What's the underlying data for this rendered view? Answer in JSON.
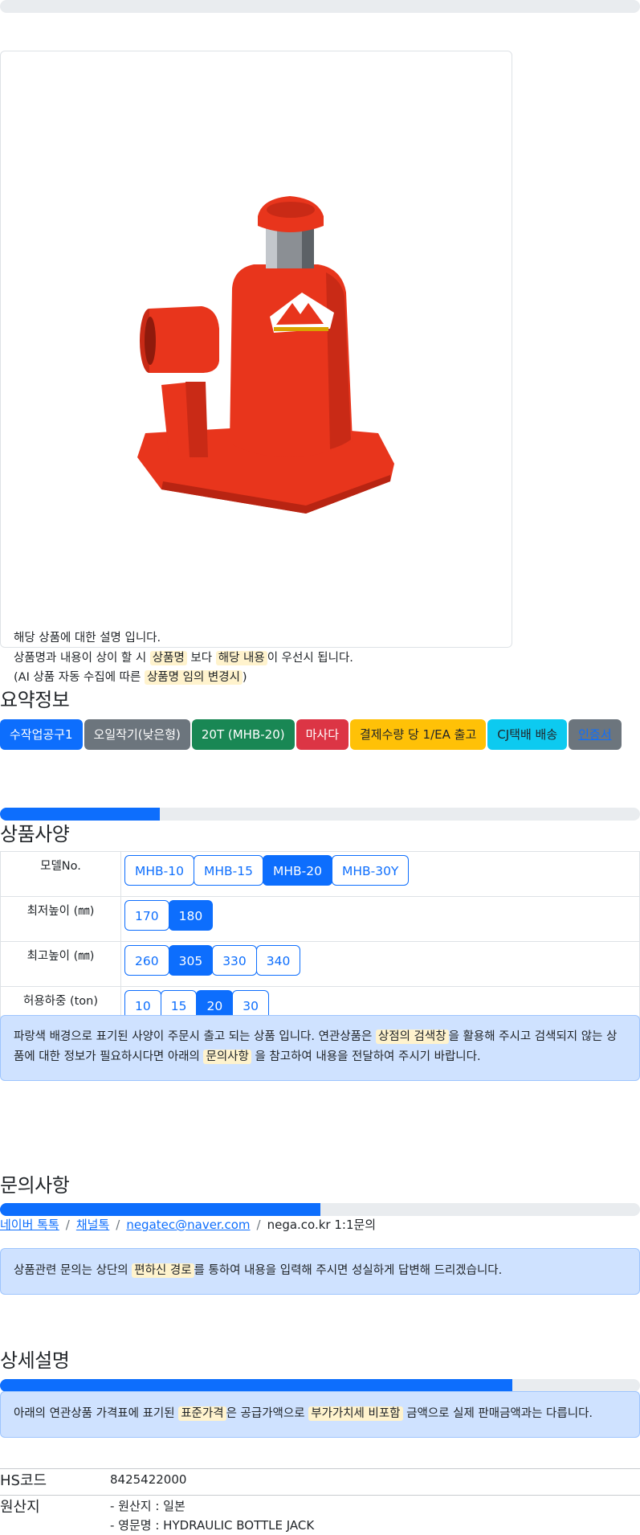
{
  "product_card": {
    "image_alt": "hydraulic bottle jack",
    "desc_line1": "해당 상품에 대한 설명 입니다.",
    "desc_line2_pre": "상품명과 내용이 상이 할 시 ",
    "desc_line2_mark1": "상품명",
    "desc_line2_mid": " 보다 ",
    "desc_line2_mark2": "해당 내용",
    "desc_line2_post": "이 우선시 됩니다.",
    "desc_line3_pre": "(AI 상품 자동 수집에 따른 ",
    "desc_line3_mark": "상품명 임의 변경시",
    "desc_line3_post": ")"
  },
  "summary": {
    "title": "요약정보",
    "badges": [
      "수작업공구1",
      "오일작기(낮은형)",
      "20T (MHB-20)",
      "마사다",
      "결제수량 당 1/EA 출고",
      "CJ택배 배송"
    ],
    "link_badge": "인증서"
  },
  "specs": {
    "title": "상품사양",
    "progress": 0.25,
    "rows": [
      {
        "label": "모델No.",
        "options": [
          "MHB-10",
          "MHB-15",
          "MHB-20",
          "MHB-30Y"
        ],
        "active": 2
      },
      {
        "label": "최저높이 (㎜)",
        "options": [
          "170",
          "180"
        ],
        "active": 1
      },
      {
        "label": "최고높이 (㎜)",
        "options": [
          "260",
          "305",
          "330",
          "340"
        ],
        "active": 1
      },
      {
        "label": "허용하중 (ton)",
        "options": [
          "10",
          "15",
          "20",
          "30"
        ],
        "active": 2
      }
    ],
    "alert_pre": "파랑색 배경으로 표기된 사양이 주문시 출고 되는 상품 입니다. 연관상품은 ",
    "alert_mark1": "상점의 검색창",
    "alert_mid": "을 활용해 주시고 검색되지 않는 상품에 대한 정보가 필요하시다면 아래의 ",
    "alert_mark2": "문의사항",
    "alert_post": " 을 참고하여 내용을 전달하여 주시기 바랍니다."
  },
  "inquiry": {
    "title": "문의사항",
    "progress": 0.5,
    "link1": "네이버 톡톡",
    "link2": "채널톡",
    "link3": "negatec@naver.com",
    "text4": "nega.co.kr 1:1문의",
    "sep": "/",
    "alert_pre": "상품관련 문의는 상단의 ",
    "alert_mark": "편하신 경로",
    "alert_post": "를 통하여 내용을 입력해 주시면 성실하게 답변해 드리겠습니다."
  },
  "detail": {
    "title": "상세설명",
    "progress": 0.8,
    "alert_pre": "아래의 연관상품 가격표에 표기된 ",
    "alert_mark1": "표준가격",
    "alert_mid": "은 공급가액으로 ",
    "alert_mark2": "부가가치세 비포함",
    "alert_post": " 금액으로 실제 판매금액과는 다릅니다.",
    "hs_label": "HS코드",
    "hs_value": "8425422000",
    "origin_label": "원산지",
    "origin_line1": "- 원산지 : 일본",
    "origin_line2": "- 영문명 : HYDRAULIC BOTTLE JACK"
  },
  "colors": {
    "primary": "#0d6efd",
    "jack_red": "#e8351c"
  }
}
